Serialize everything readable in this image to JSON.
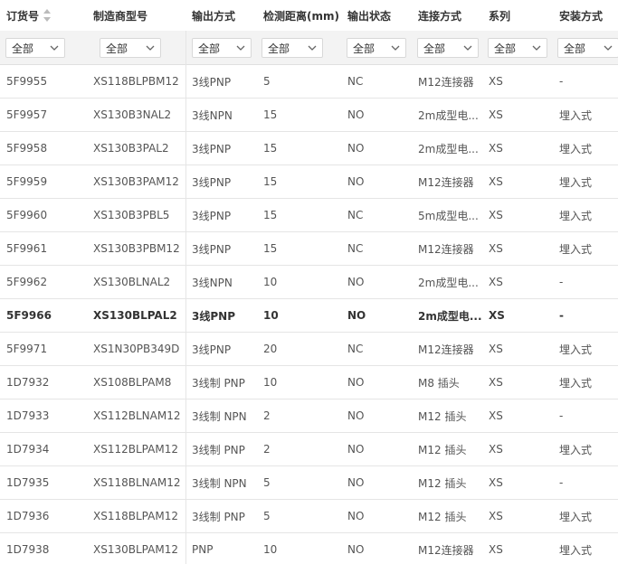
{
  "columns": [
    "订货号",
    "制造商型号",
    "输出方式",
    "检测距离(mm)",
    "输出状态",
    "连接方式",
    "系列",
    "安装方式"
  ],
  "filter_value": "全部",
  "rows": [
    [
      "5F9955",
      "XS118BLPBM12",
      "3线PNP",
      "5",
      "NC",
      "M12连接器",
      "XS",
      "-"
    ],
    [
      "5F9957",
      "XS130B3NAL2",
      "3线NPN",
      "15",
      "NO",
      "2m成型电...",
      "XS",
      "埋入式"
    ],
    [
      "5F9958",
      "XS130B3PAL2",
      "3线PNP",
      "15",
      "NO",
      "2m成型电...",
      "XS",
      "埋入式"
    ],
    [
      "5F9959",
      "XS130B3PAM12",
      "3线PNP",
      "15",
      "NO",
      "M12连接器",
      "XS",
      "埋入式"
    ],
    [
      "5F9960",
      "XS130B3PBL5",
      "3线PNP",
      "15",
      "NC",
      "5m成型电...",
      "XS",
      "埋入式"
    ],
    [
      "5F9961",
      "XS130B3PBM12",
      "3线PNP",
      "15",
      "NC",
      "M12连接器",
      "XS",
      "埋入式"
    ],
    [
      "5F9962",
      "XS130BLNAL2",
      "3线NPN",
      "10",
      "NO",
      "2m成型电...",
      "XS",
      "-"
    ],
    [
      "5F9966",
      "XS130BLPAL2",
      "3线PNP",
      "10",
      "NO",
      "2m成型电...",
      "XS",
      "-"
    ],
    [
      "5F9971",
      "XS1N30PB349D",
      "3线PNP",
      "20",
      "NC",
      "M12连接器",
      "XS",
      "埋入式"
    ],
    [
      "1D7932",
      "XS108BLPAM8",
      "3线制 PNP",
      "10",
      "NO",
      "M8 插头",
      "XS",
      "埋入式"
    ],
    [
      "1D7933",
      "XS112BLNAM12",
      "3线制 NPN",
      "2",
      "NO",
      "M12 插头",
      "XS",
      "-"
    ],
    [
      "1D7934",
      "XS112BLPAM12",
      "3线制 PNP",
      "2",
      "NO",
      "M12 插头",
      "XS",
      "埋入式"
    ],
    [
      "1D7935",
      "XS118BLNAM12",
      "3线制 NPN",
      "5",
      "NO",
      "M12 插头",
      "XS",
      "-"
    ],
    [
      "1D7936",
      "XS118BLPAM12",
      "3线制 PNP",
      "5",
      "NO",
      "M12 插头",
      "XS",
      "埋入式"
    ],
    [
      "1D7938",
      "XS130BLPAM12",
      "PNP",
      "10",
      "NO",
      "M12连接器",
      "XS",
      "埋入式"
    ]
  ],
  "highlighted_row": 7,
  "colors": {
    "header_text": "#333333",
    "body_text": "#555555",
    "filter_bg": "#f3f3f3",
    "border": "#e5e5e5"
  },
  "icons": {
    "sort": "sort-icon",
    "dropdown": "chevron-down-icon"
  }
}
